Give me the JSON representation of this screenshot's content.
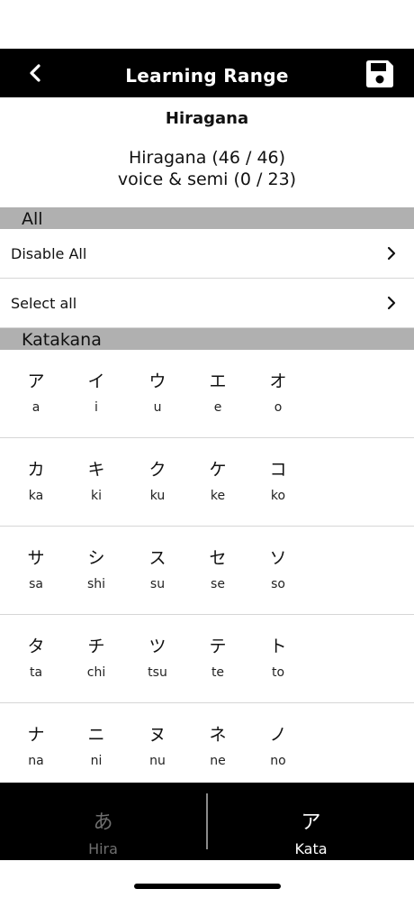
{
  "nav": {
    "title": "Learning Range",
    "back_icon": "chevron-left-icon",
    "save_icon": "floppy-disk-icon"
  },
  "info": {
    "kind": "Hiragana",
    "hiragana_count": "Hiragana (46 / 46)",
    "voice_count": "voice & semi (0 / 23)"
  },
  "sections": {
    "all": {
      "header": "All",
      "items": [
        {
          "label": "Disable All"
        },
        {
          "label": "Select all"
        }
      ]
    },
    "katakana": {
      "header": "Katakana",
      "rows": [
        [
          {
            "glyph": "ア",
            "roman": "a"
          },
          {
            "glyph": "イ",
            "roman": "i"
          },
          {
            "glyph": "ウ",
            "roman": "u"
          },
          {
            "glyph": "エ",
            "roman": "e"
          },
          {
            "glyph": "オ",
            "roman": "o"
          }
        ],
        [
          {
            "glyph": "カ",
            "roman": "ka"
          },
          {
            "glyph": "キ",
            "roman": "ki"
          },
          {
            "glyph": "ク",
            "roman": "ku"
          },
          {
            "glyph": "ケ",
            "roman": "ke"
          },
          {
            "glyph": "コ",
            "roman": "ko"
          }
        ],
        [
          {
            "glyph": "サ",
            "roman": "sa"
          },
          {
            "glyph": "シ",
            "roman": "shi"
          },
          {
            "glyph": "ス",
            "roman": "su"
          },
          {
            "glyph": "セ",
            "roman": "se"
          },
          {
            "glyph": "ソ",
            "roman": "so"
          }
        ],
        [
          {
            "glyph": "タ",
            "roman": "ta"
          },
          {
            "glyph": "チ",
            "roman": "chi"
          },
          {
            "glyph": "ツ",
            "roman": "tsu"
          },
          {
            "glyph": "テ",
            "roman": "te"
          },
          {
            "glyph": "ト",
            "roman": "to"
          }
        ],
        [
          {
            "glyph": "ナ",
            "roman": "na"
          },
          {
            "glyph": "ニ",
            "roman": "ni"
          },
          {
            "glyph": "ヌ",
            "roman": "nu"
          },
          {
            "glyph": "ネ",
            "roman": "ne"
          },
          {
            "glyph": "ノ",
            "roman": "no"
          }
        ]
      ]
    }
  },
  "tabbar": {
    "tabs": [
      {
        "glyph": "あ",
        "label": "Hira",
        "active": false
      },
      {
        "glyph": "ア",
        "label": "Kata",
        "active": true
      }
    ]
  },
  "colors": {
    "nav_bg": "#000000",
    "section_header_bg": "#b0b0b0",
    "tab_inactive": "#6f6f6f",
    "tab_active": "#ffffff"
  }
}
